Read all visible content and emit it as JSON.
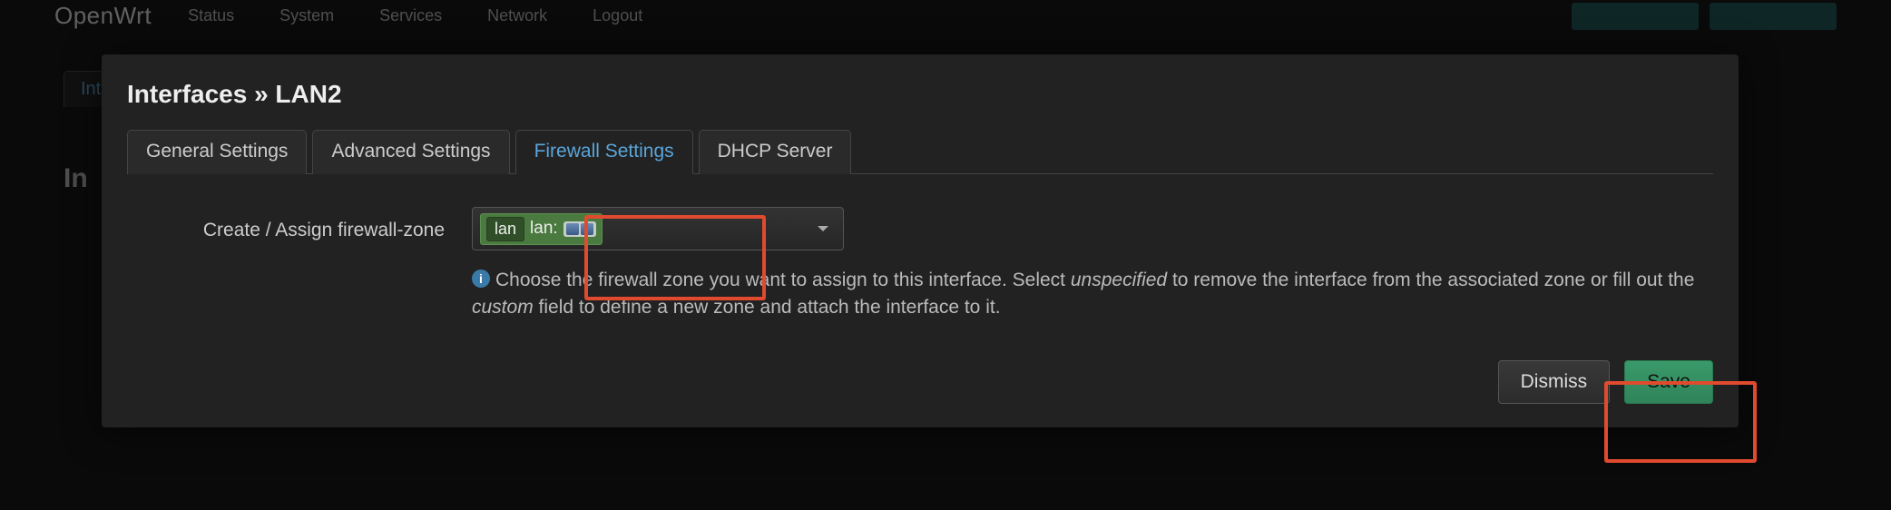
{
  "topnav": {
    "brand": "OpenWrt",
    "links": [
      "Status",
      "System",
      "Services",
      "Network",
      "Logout"
    ]
  },
  "background": {
    "tab": "Int",
    "heading": "In"
  },
  "modal": {
    "title": "Interfaces » LAN2",
    "tabs": [
      {
        "label": "General Settings",
        "active": false
      },
      {
        "label": "Advanced Settings",
        "active": false
      },
      {
        "label": "Firewall Settings",
        "active": true
      },
      {
        "label": "DHCP Server",
        "active": false
      }
    ],
    "form": {
      "zone_label": "Create / Assign firewall-zone",
      "zone_selected": {
        "badge": "lan",
        "text": "lan:"
      },
      "help_prefix": "Choose the firewall zone you want to assign to this interface. Select ",
      "help_em1": "unspecified",
      "help_mid": " to remove the interface from the associated zone or fill out the ",
      "help_em2": "custom",
      "help_suffix": " field to define a new zone and attach the interface to it."
    },
    "footer": {
      "dismiss": "Dismiss",
      "save": "Save"
    }
  }
}
